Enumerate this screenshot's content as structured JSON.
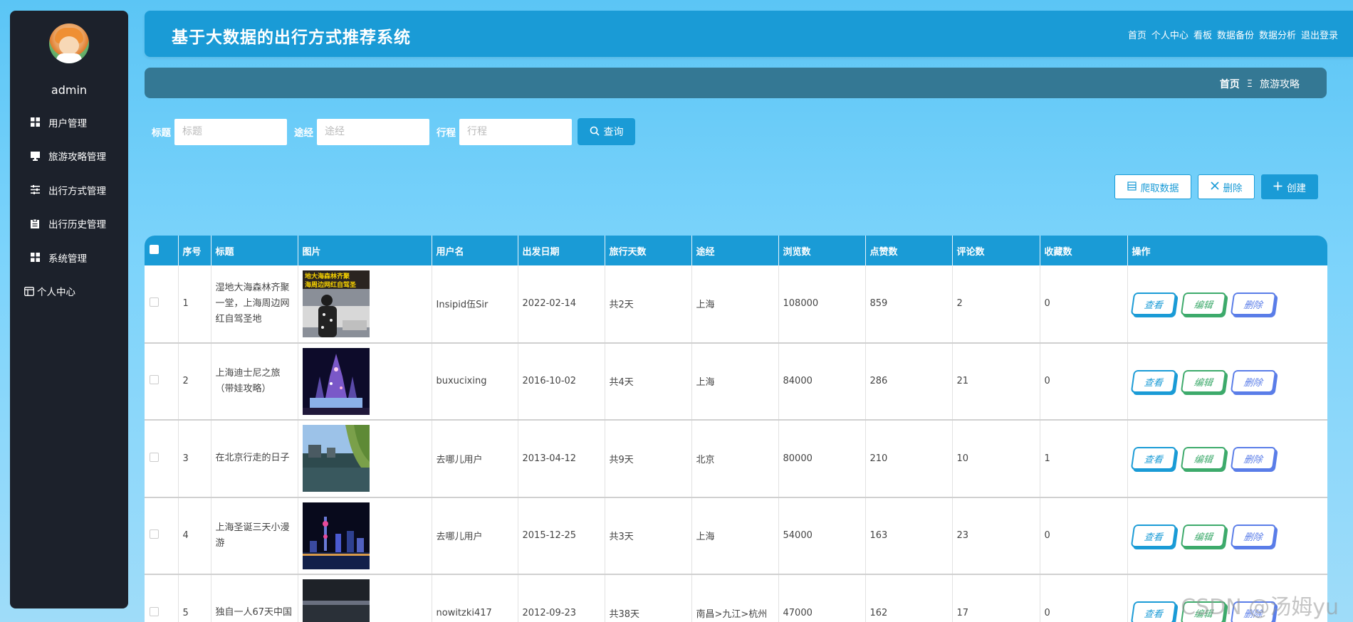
{
  "sidebar": {
    "username": "admin",
    "items": [
      {
        "label": "用户管理",
        "icon": "grid-icon"
      },
      {
        "label": "旅游攻略管理",
        "icon": "monitor-icon"
      },
      {
        "label": "出行方式管理",
        "icon": "sliders-icon"
      },
      {
        "label": "出行历史管理",
        "icon": "clipboard-icon"
      },
      {
        "label": "系统管理",
        "icon": "grid-icon"
      },
      {
        "label": "个人中心",
        "icon": "window-icon"
      }
    ]
  },
  "header": {
    "title": "基于大数据的出行方式推荐系统",
    "nav": [
      "首页",
      "个人中心",
      "看板",
      "数据备份",
      "数据分析",
      "退出登录"
    ]
  },
  "breadcrumb": {
    "home": "首页",
    "separator": "Ξ",
    "current": "旅游攻略"
  },
  "search": {
    "fields": [
      {
        "label": "标题",
        "placeholder": "标题"
      },
      {
        "label": "途经",
        "placeholder": "途经"
      },
      {
        "label": "行程",
        "placeholder": "行程"
      }
    ],
    "button": "查询"
  },
  "actions": {
    "crawl": "爬取数据",
    "delete": "删除",
    "create": "创建"
  },
  "table": {
    "columns": [
      "序号",
      "标题",
      "图片",
      "用户名",
      "出发日期",
      "旅行天数",
      "途经",
      "浏览数",
      "点赞数",
      "评论数",
      "收藏数",
      "操作"
    ],
    "rows": [
      {
        "no": "1",
        "title": "湿地大海森林齐聚一堂，上海周边网红自驾圣地",
        "thumb_caption": "地大海森林齐聚 海周边网红自驾圣",
        "user": "Insipid伍Sir",
        "date": "2022-02-14",
        "days": "共2天",
        "route": "上海",
        "views": "108000",
        "likes": "859",
        "comments": "2",
        "favs": "0"
      },
      {
        "no": "2",
        "title": "上海迪士尼之旅（带娃攻略）",
        "user": "buxucixing",
        "date": "2016-10-02",
        "days": "共4天",
        "route": "上海",
        "views": "84000",
        "likes": "286",
        "comments": "21",
        "favs": "0"
      },
      {
        "no": "3",
        "title": "在北京行走的日子",
        "user": "去哪儿用户",
        "date": "2013-04-12",
        "days": "共9天",
        "route": "北京",
        "views": "80000",
        "likes": "210",
        "comments": "10",
        "favs": "1"
      },
      {
        "no": "4",
        "title": "上海圣诞三天小漫游",
        "user": "去哪儿用户",
        "date": "2015-12-25",
        "days": "共3天",
        "route": "上海",
        "views": "54000",
        "likes": "163",
        "comments": "23",
        "favs": "0"
      },
      {
        "no": "5",
        "title": "独自一人67天中国",
        "user": "nowitzki417",
        "date": "2012-09-23",
        "days": "共38天",
        "route": "南昌>九江>杭州",
        "views": "47000",
        "likes": "162",
        "comments": "17",
        "favs": "0"
      }
    ],
    "ops": {
      "view": "查看",
      "edit": "编辑",
      "delete": "删除"
    }
  },
  "watermark": "CSDN @汤姆yu"
}
